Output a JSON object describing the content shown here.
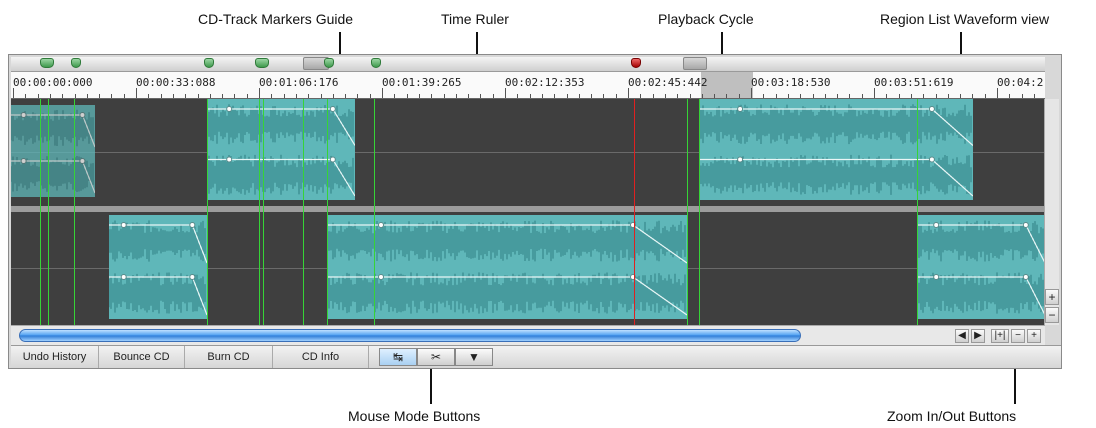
{
  "callouts": {
    "cd_markers": "CD-Track Markers Guide",
    "time_ruler": "Time Ruler",
    "playback_cycle": "Playback Cycle",
    "region_waveform": "Region List Waveform view",
    "mouse_modes": "Mouse Mode Buttons",
    "zoom_buttons": "Zoom In/Out Buttons"
  },
  "ruler": {
    "labels": [
      "00:00:00:000",
      "00:00:33:088",
      "00:01:06:176",
      "00:01:39:265",
      "00:02:12:353",
      "00:02:45:442",
      "00:03:18:530",
      "00:03:51:619",
      "00:04:2"
    ]
  },
  "bottom_tabs": {
    "undo": "Undo History",
    "bounce": "Bounce CD",
    "burn": "Burn CD",
    "info": "CD Info"
  },
  "mouse_modes": [
    {
      "icon": "arrow-move-icon",
      "active": true
    },
    {
      "icon": "arrow-scissors-icon",
      "active": false
    },
    {
      "icon": "marker-pin-icon",
      "active": false
    }
  ],
  "zoom": {
    "in": "+",
    "out": "−",
    "fit": "|+|",
    "left": "◀",
    "right": "▶"
  },
  "colors": {
    "waveform": "#5fb7b9",
    "marker_line": "#36d436",
    "playhead": "#e02020",
    "scroll_thumb": "#3d8fe6"
  }
}
